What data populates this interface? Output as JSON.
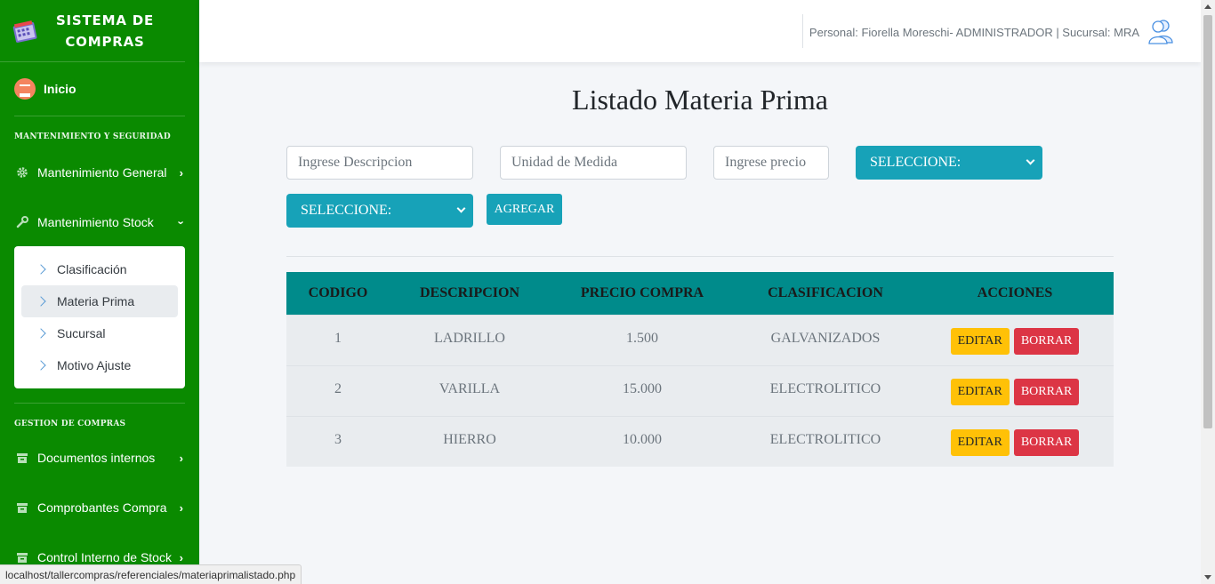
{
  "sidebar": {
    "brand": "SISTEMA DE COMPRAS",
    "home": "Inicio",
    "section1": "MANTENIMIENTO Y SEGURIDAD",
    "section2": "GESTION DE COMPRAS",
    "items": {
      "mant_general": "Mantenimiento General",
      "mant_stock": "Mantenimiento Stock",
      "doc_internos": "Documentos internos",
      "comprobantes": "Comprobantes Compra",
      "control_stock": "Control Interno de Stock"
    },
    "submenu": [
      "Clasificación",
      "Materia Prima",
      "Sucursal",
      "Motivo Ajuste"
    ],
    "active_submenu": "Materia Prima"
  },
  "topbar": {
    "user_text": "Personal: Fiorella Moreschi- ADMINISTRADOR | Sucursal: MRA"
  },
  "page": {
    "title": "Listado Materia Prima"
  },
  "form": {
    "descripcion_placeholder": "Ingrese Descripcion",
    "unidad_placeholder": "Unidad de Medida",
    "precio_placeholder": "Ingrese precio",
    "select1": "SELECCIONE:",
    "select2": "SELECCIONE:",
    "add_button": "AGREGAR"
  },
  "table": {
    "headers": [
      "CODIGO",
      "DESCRIPCION",
      "PRECIO COMPRA",
      "CLASIFICACION",
      "ACCIONES"
    ],
    "rows": [
      {
        "codigo": "1",
        "descripcion": "LADRILLO",
        "precio": "1.500",
        "clasificacion": "GALVANIZADOS"
      },
      {
        "codigo": "2",
        "descripcion": "VARILLA",
        "precio": "15.000",
        "clasificacion": "ELECTROLITICO"
      },
      {
        "codigo": "3",
        "descripcion": "HIERRO",
        "precio": "10.000",
        "clasificacion": "ELECTROLITICO"
      }
    ],
    "edit_label": "EDITAR",
    "delete_label": "BORRAR"
  },
  "status_url": "localhost/tallercompras/referenciales/materiaprimalistado.php",
  "colors": {
    "sidebar": "#0a8a00",
    "table_header": "#008b8b",
    "primary": "#17a2b8",
    "edit": "#ffc107",
    "delete": "#dc3545"
  }
}
